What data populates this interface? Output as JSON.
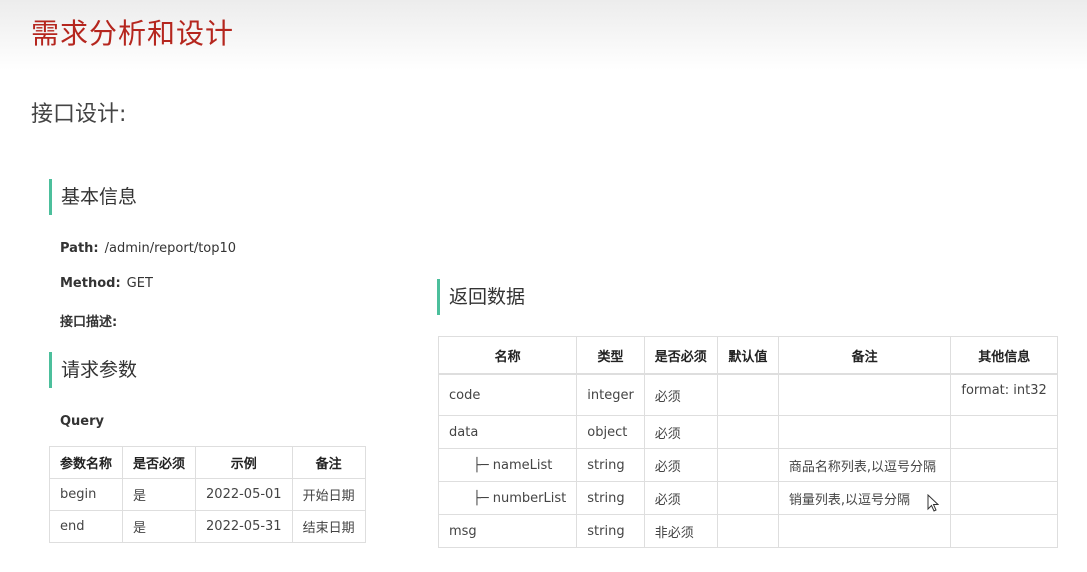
{
  "title": "需求分析和设计",
  "subtitle": "接口设计:",
  "basic_info": {
    "heading": "基本信息",
    "path_label": "Path:",
    "path_value": "/admin/report/top10",
    "method_label": "Method:",
    "method_value": "GET",
    "desc_label": "接口描述:"
  },
  "request": {
    "heading": "请求参数",
    "query_label": "Query",
    "headers": [
      "参数名称",
      "是否必须",
      "示例",
      "备注"
    ],
    "rows": [
      [
        "begin",
        "是",
        "2022-05-01",
        "开始日期"
      ],
      [
        "end",
        "是",
        "2022-05-31",
        "结束日期"
      ]
    ]
  },
  "response": {
    "heading": "返回数据",
    "headers": [
      "名称",
      "类型",
      "是否必须",
      "默认值",
      "备注",
      "其他信息"
    ],
    "rows": [
      [
        "code",
        "integer",
        "必须",
        "",
        "",
        "format: int32"
      ],
      [
        "data",
        "object",
        "必须",
        "",
        "",
        ""
      ],
      [
        "├─ nameList",
        "string",
        "必须",
        "",
        "商品名称列表,以逗号分隔",
        ""
      ],
      [
        "├─ numberList",
        "string",
        "必须",
        "",
        "销量列表,以逗号分隔",
        ""
      ],
      [
        "msg",
        "string",
        "非必须",
        "",
        "",
        ""
      ]
    ]
  },
  "icons": {
    "cursor": "mouse-pointer-icon"
  }
}
